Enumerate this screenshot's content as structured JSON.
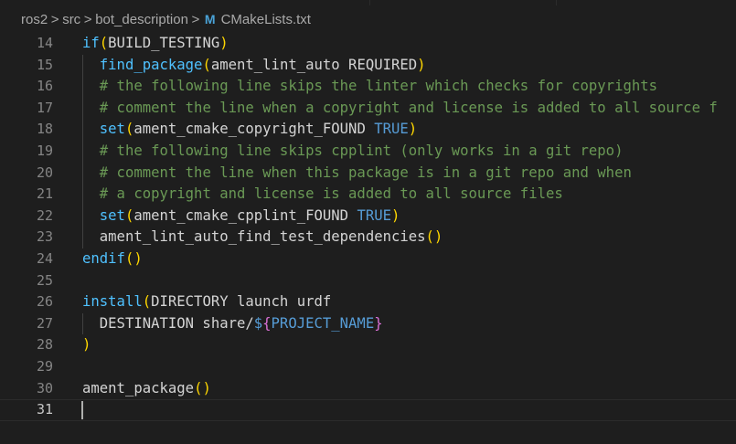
{
  "breadcrumb": {
    "segments": [
      "ros2",
      "src",
      "bot_description"
    ],
    "separator": ">",
    "file_icon": "M",
    "file_name": "CMakeLists.txt"
  },
  "editor": {
    "current_line": 31,
    "lines": [
      {
        "num": "14",
        "tokens": [
          {
            "t": "if",
            "c": "fn"
          },
          {
            "t": "(",
            "c": "p1"
          },
          {
            "t": "BUILD_TESTING",
            "c": "tx"
          },
          {
            "t": ")",
            "c": "p1"
          }
        ]
      },
      {
        "num": "15",
        "tokens": [
          {
            "t": "  ",
            "c": "tx"
          },
          {
            "t": "find_package",
            "c": "fn"
          },
          {
            "t": "(",
            "c": "p1"
          },
          {
            "t": "ament_lint_auto REQUIRED",
            "c": "tx"
          },
          {
            "t": ")",
            "c": "p1"
          }
        ]
      },
      {
        "num": "16",
        "tokens": [
          {
            "t": "  ",
            "c": "tx"
          },
          {
            "t": "# the following line skips the linter which checks for copyrights",
            "c": "cm"
          }
        ]
      },
      {
        "num": "17",
        "tokens": [
          {
            "t": "  ",
            "c": "tx"
          },
          {
            "t": "# comment the line when a copyright and license is added to all source f",
            "c": "cm"
          }
        ]
      },
      {
        "num": "18",
        "tokens": [
          {
            "t": "  ",
            "c": "tx"
          },
          {
            "t": "set",
            "c": "fn"
          },
          {
            "t": "(",
            "c": "p1"
          },
          {
            "t": "ament_cmake_copyright_FOUND ",
            "c": "tx"
          },
          {
            "t": "TRUE",
            "c": "kw"
          },
          {
            "t": ")",
            "c": "p1"
          }
        ]
      },
      {
        "num": "19",
        "tokens": [
          {
            "t": "  ",
            "c": "tx"
          },
          {
            "t": "# the following line skips cpplint (only works in a git repo)",
            "c": "cm"
          }
        ]
      },
      {
        "num": "20",
        "tokens": [
          {
            "t": "  ",
            "c": "tx"
          },
          {
            "t": "# comment the line when this package is in a git repo and when",
            "c": "cm"
          }
        ]
      },
      {
        "num": "21",
        "tokens": [
          {
            "t": "  ",
            "c": "tx"
          },
          {
            "t": "# a copyright and license is added to all source files",
            "c": "cm"
          }
        ]
      },
      {
        "num": "22",
        "tokens": [
          {
            "t": "  ",
            "c": "tx"
          },
          {
            "t": "set",
            "c": "fn"
          },
          {
            "t": "(",
            "c": "p1"
          },
          {
            "t": "ament_cmake_cpplint_FOUND ",
            "c": "tx"
          },
          {
            "t": "TRUE",
            "c": "kw"
          },
          {
            "t": ")",
            "c": "p1"
          }
        ]
      },
      {
        "num": "23",
        "tokens": [
          {
            "t": "  ",
            "c": "tx"
          },
          {
            "t": "ament_lint_auto_find_test_dependencies",
            "c": "tx"
          },
          {
            "t": "()",
            "c": "p1"
          }
        ]
      },
      {
        "num": "24",
        "tokens": [
          {
            "t": "endif",
            "c": "fn"
          },
          {
            "t": "()",
            "c": "p1"
          }
        ]
      },
      {
        "num": "25",
        "tokens": []
      },
      {
        "num": "26",
        "tokens": [
          {
            "t": "install",
            "c": "fn"
          },
          {
            "t": "(",
            "c": "p1"
          },
          {
            "t": "DIRECTORY launch urdf",
            "c": "tx"
          }
        ]
      },
      {
        "num": "27",
        "tokens": [
          {
            "t": "  DESTINATION share/",
            "c": "tx"
          },
          {
            "t": "$",
            "c": "kw"
          },
          {
            "t": "{",
            "c": "p2"
          },
          {
            "t": "PROJECT_NAME",
            "c": "var"
          },
          {
            "t": "}",
            "c": "p2"
          }
        ]
      },
      {
        "num": "28",
        "tokens": [
          {
            "t": ")",
            "c": "p1"
          }
        ]
      },
      {
        "num": "29",
        "tokens": []
      },
      {
        "num": "30",
        "tokens": [
          {
            "t": "ament_package",
            "c": "tx"
          },
          {
            "t": "()",
            "c": "p1"
          }
        ]
      },
      {
        "num": "31",
        "tokens": []
      }
    ]
  }
}
